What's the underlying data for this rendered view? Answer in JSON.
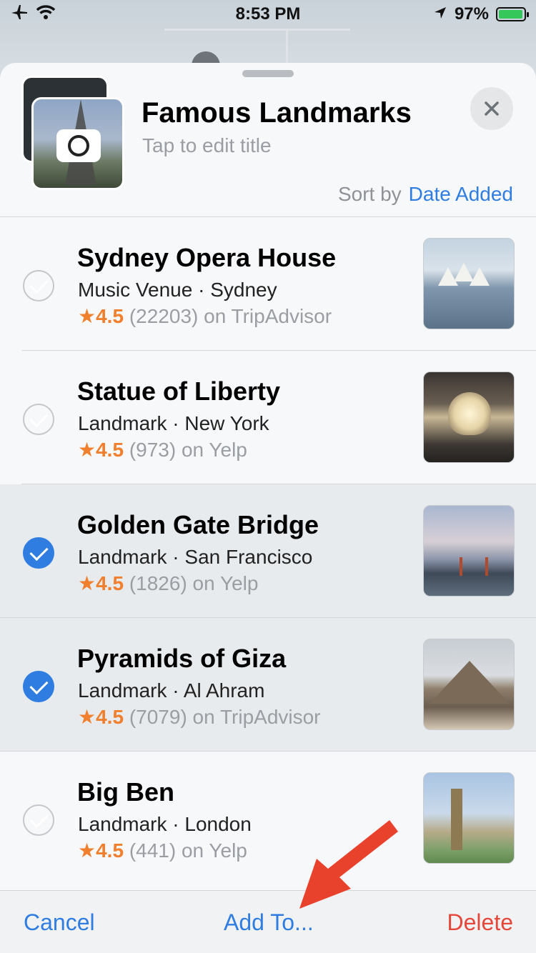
{
  "status_bar": {
    "time": "8:53 PM",
    "battery": "97%",
    "battery_level": 0.97,
    "icons": [
      "airplane-mode-icon",
      "wifi-icon",
      "location-arrow-icon",
      "battery-charging-icon"
    ]
  },
  "header": {
    "title": "Famous Landmarks",
    "subtitle": "Tap to edit title",
    "sort_label": "Sort by",
    "sort_value": "Date Added"
  },
  "items": [
    {
      "name": "Sydney Opera House",
      "meta": "Music Venue · Sydney",
      "rating": "4.5",
      "reviews": "(22203) on TripAdvisor",
      "selected": false
    },
    {
      "name": "Statue of Liberty",
      "meta": "Landmark · New York",
      "rating": "4.5",
      "reviews": "(973) on Yelp",
      "selected": false
    },
    {
      "name": "Golden Gate Bridge",
      "meta": "Landmark · San Francisco",
      "rating": "4.5",
      "reviews": "(1826) on Yelp",
      "selected": true
    },
    {
      "name": "Pyramids of Giza",
      "meta": "Landmark · Al Ahram",
      "rating": "4.5",
      "reviews": "(7079) on TripAdvisor",
      "selected": true
    },
    {
      "name": "Big Ben",
      "meta": "Landmark · London",
      "rating": "4.5",
      "reviews": "(441) on Yelp",
      "selected": false
    }
  ],
  "toolbar": {
    "cancel_label": "Cancel",
    "add_to_label": "Add To...",
    "delete_label": "Delete"
  },
  "colors": {
    "accent": "#2f7de1",
    "rating": "#f07f2e",
    "destructive": "#e5483b",
    "annotation_arrow": "#e8412c"
  }
}
